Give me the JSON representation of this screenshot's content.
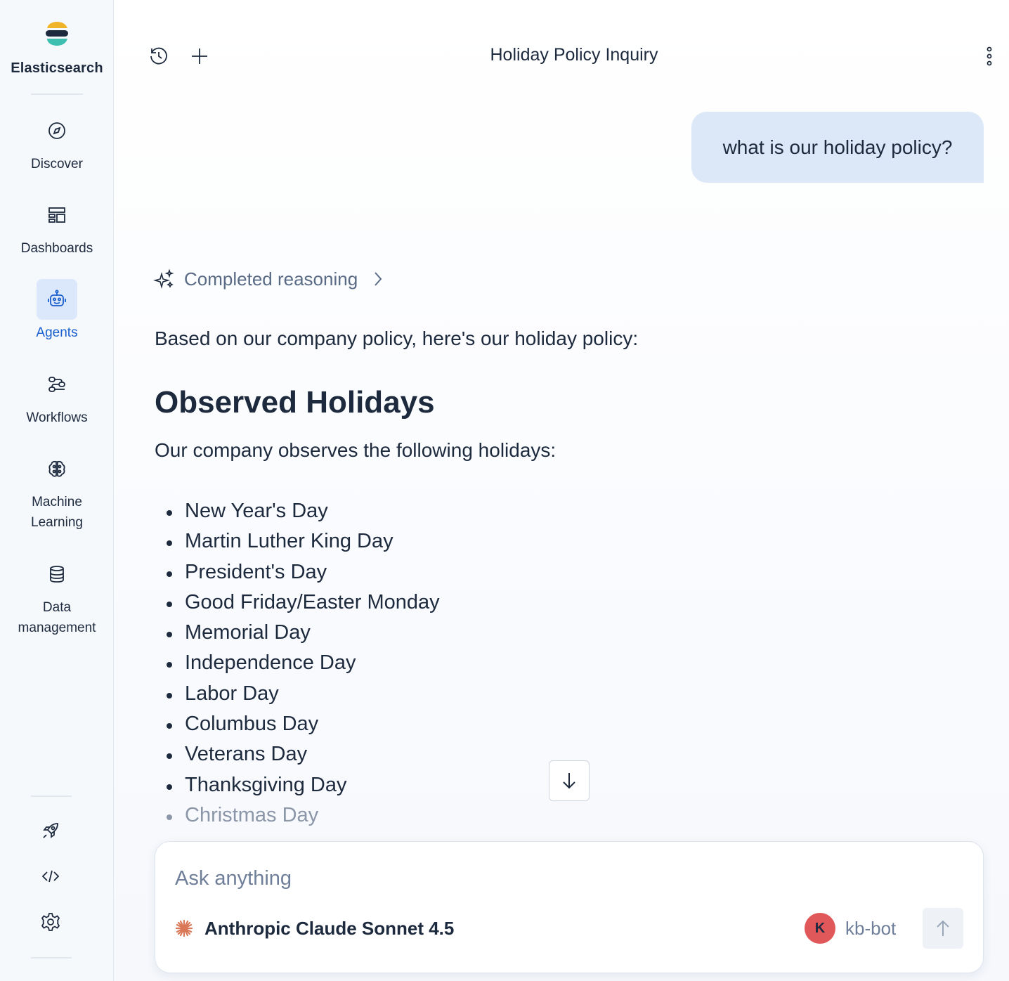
{
  "sidebar": {
    "brand": "Elasticsearch",
    "brand_colors": [
      "#f0b429",
      "#1d2a3e",
      "#3fbfb0"
    ],
    "items": [
      {
        "label": "Discover",
        "icon": "compass-icon",
        "active": false
      },
      {
        "label": "Dashboards",
        "icon": "dashboard-icon",
        "active": false
      },
      {
        "label": "Agents",
        "icon": "robot-icon",
        "active": true
      },
      {
        "label": "Workflows",
        "icon": "workflow-icon",
        "active": false
      },
      {
        "label": "Machine Learning",
        "icon": "brain-icon",
        "active": false
      },
      {
        "label": "Data management",
        "icon": "database-icon",
        "active": false
      }
    ],
    "utilities": [
      "rocket-icon",
      "code-icon",
      "gear-icon"
    ]
  },
  "header": {
    "title": "Holiday Policy Inquiry",
    "history_icon": "history-icon",
    "new_icon": "plus-icon",
    "menu_icon": "kebab-menu-icon"
  },
  "conversation": {
    "user_message": "what is our holiday policy?",
    "reasoning_label": "Completed reasoning",
    "intro": "Based on our company policy, here's our holiday policy:",
    "heading": "Observed Holidays",
    "subtext": "Our company observes the following holidays:",
    "holidays": [
      "New Year's Day",
      "Martin Luther King Day",
      "President's Day",
      "Good Friday/Easter Monday",
      "Memorial Day",
      "Independence Day",
      "Labor Day",
      "Columbus Day",
      "Veterans Day",
      "Thanksgiving Day",
      "Christmas Day"
    ]
  },
  "composer": {
    "placeholder": "Ask anything",
    "model": "Anthropic Claude Sonnet 4.5",
    "model_icon": "anthropic-icon",
    "agent_initial": "K",
    "agent_name": "kb-bot",
    "send_icon": "arrow-up-icon",
    "accent_color": "#d97757"
  }
}
